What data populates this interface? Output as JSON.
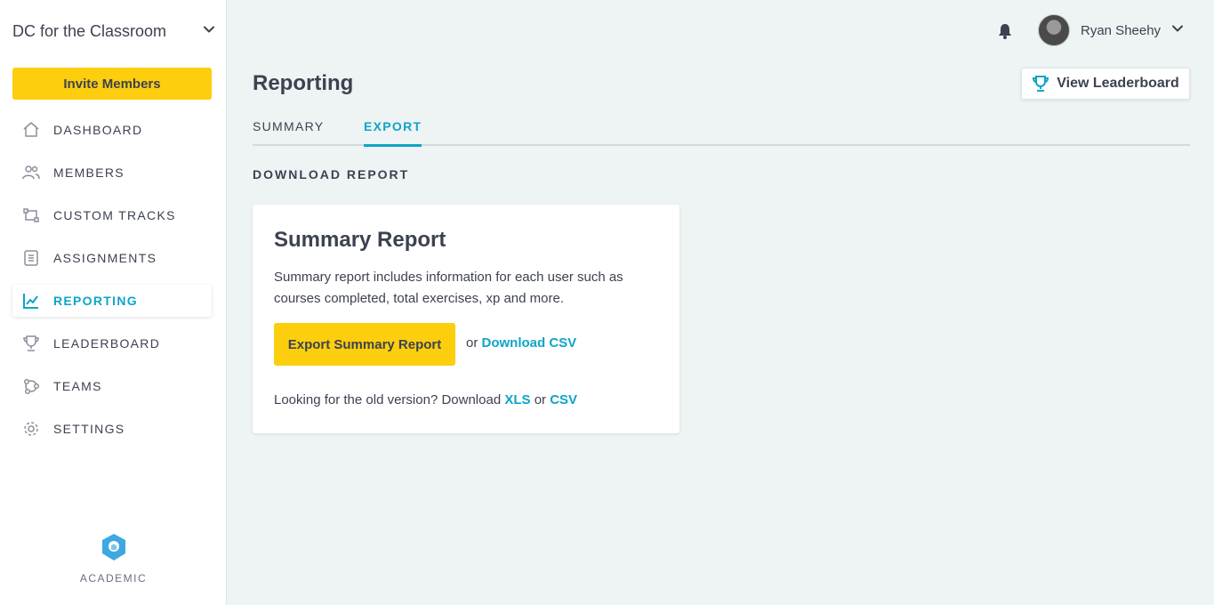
{
  "sidebar": {
    "org_name": "DC for the Classroom",
    "invite_label": "Invite Members",
    "items": [
      {
        "label": "DASHBOARD",
        "icon": "home-icon"
      },
      {
        "label": "MEMBERS",
        "icon": "members-icon"
      },
      {
        "label": "CUSTOM TRACKS",
        "icon": "tracks-icon"
      },
      {
        "label": "ASSIGNMENTS",
        "icon": "assignments-icon"
      },
      {
        "label": "REPORTING",
        "icon": "chart-icon",
        "active": true
      },
      {
        "label": "LEADERBOARD",
        "icon": "trophy-icon"
      },
      {
        "label": "TEAMS",
        "icon": "teams-icon"
      },
      {
        "label": "SETTINGS",
        "icon": "gear-icon"
      }
    ],
    "footer_label": "ACADEMIC"
  },
  "header": {
    "user_name": "Ryan Sheehy"
  },
  "main": {
    "title": "Reporting",
    "leaderboard_button": "View Leaderboard",
    "tabs": [
      {
        "label": "SUMMARY",
        "active": false
      },
      {
        "label": "EXPORT",
        "active": true
      }
    ],
    "section_title": "DOWNLOAD REPORT",
    "card": {
      "title": "Summary Report",
      "description": "Summary report includes information for each user such as courses completed, total exercises, xp and more.",
      "export_button": "Export Summary Report",
      "or_text": "or",
      "download_csv_link": "Download CSV",
      "old_version_text": "Looking for the old version? Download",
      "xls_link": "XLS",
      "or_text_2": "or",
      "csv_link": "CSV"
    }
  },
  "colors": {
    "accent": "#0da5c7",
    "button_yellow": "#fcce0d",
    "background": "#eef3f4",
    "text": "#3d4251"
  }
}
